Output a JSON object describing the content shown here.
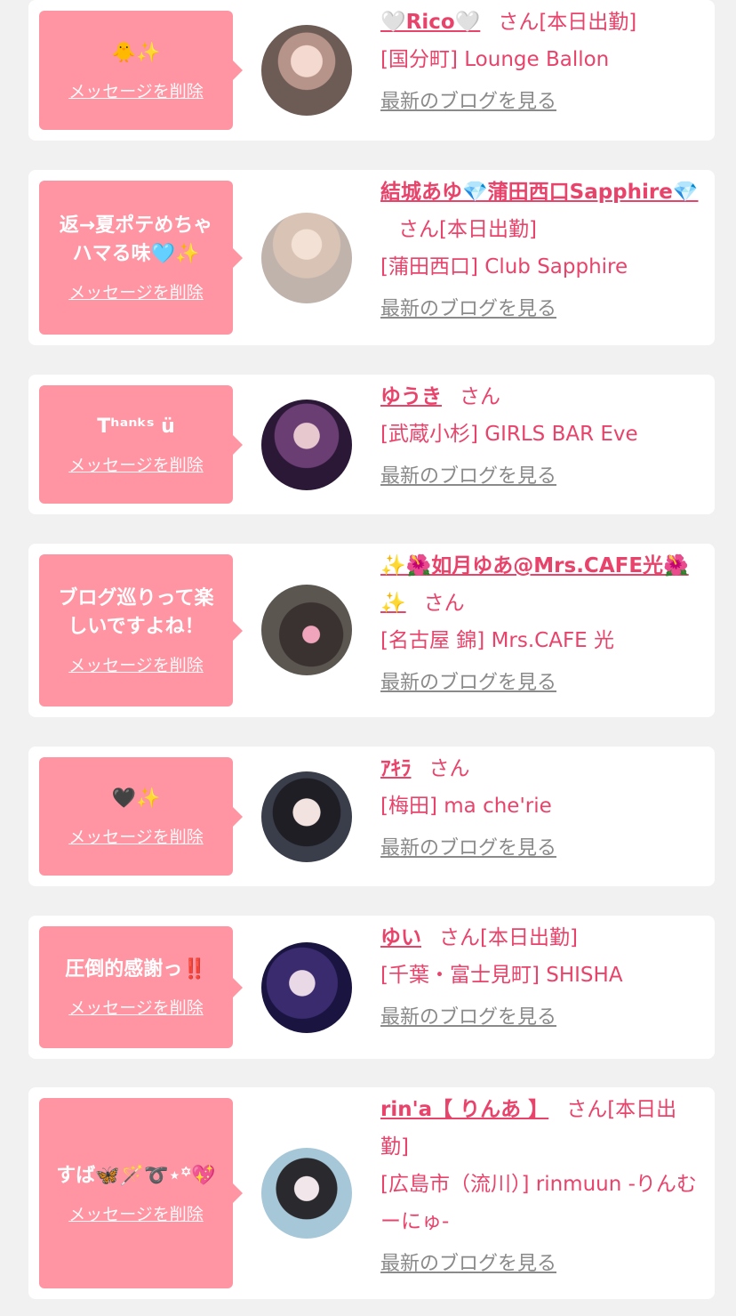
{
  "delete_label": "メッセージを削除",
  "blog_label": "最新のブログを見る",
  "suffix": "さん",
  "cards": [
    {
      "message": "🐥✨",
      "name": "🤍Rico🤍",
      "status": "[本日出勤]",
      "shop": "[国分町] Lounge Ballon"
    },
    {
      "message": "返→夏ポテめちゃハマる味🩵✨",
      "name": "結城あゆ💎蒲田西口Sapphire💎",
      "status": "[本日出勤]",
      "shop": "[蒲田西口] Club Sapphire"
    },
    {
      "message": "Tʰᵃⁿᵏˢ ü",
      "name": "ゆうき",
      "status": "",
      "shop": "[武蔵小杉] GIRLS BAR Eve"
    },
    {
      "message": "ブログ巡りって楽しいですよね！",
      "name": "✨🌺如月ゆあ@Mrs.CAFE光🌺✨",
      "status": "",
      "shop": "[名古屋 錦] Mrs.CAFE 光"
    },
    {
      "message": "🖤✨",
      "name": "ｱｷﾗ",
      "status": "",
      "shop": "[梅田] ma che'rie"
    },
    {
      "message": "圧倒的感謝っ‼️",
      "name": "ゆい",
      "status": "[本日出勤]",
      "shop": "[千葉・富士見町] SHISHA"
    },
    {
      "message": "すば🦋🪄➰⋆꙳💖",
      "name": "rin'a【 りんあ 】",
      "status": "[本日出勤]",
      "shop": "[広島市（流川）] rinmuun -りんむーにゅ-"
    }
  ]
}
